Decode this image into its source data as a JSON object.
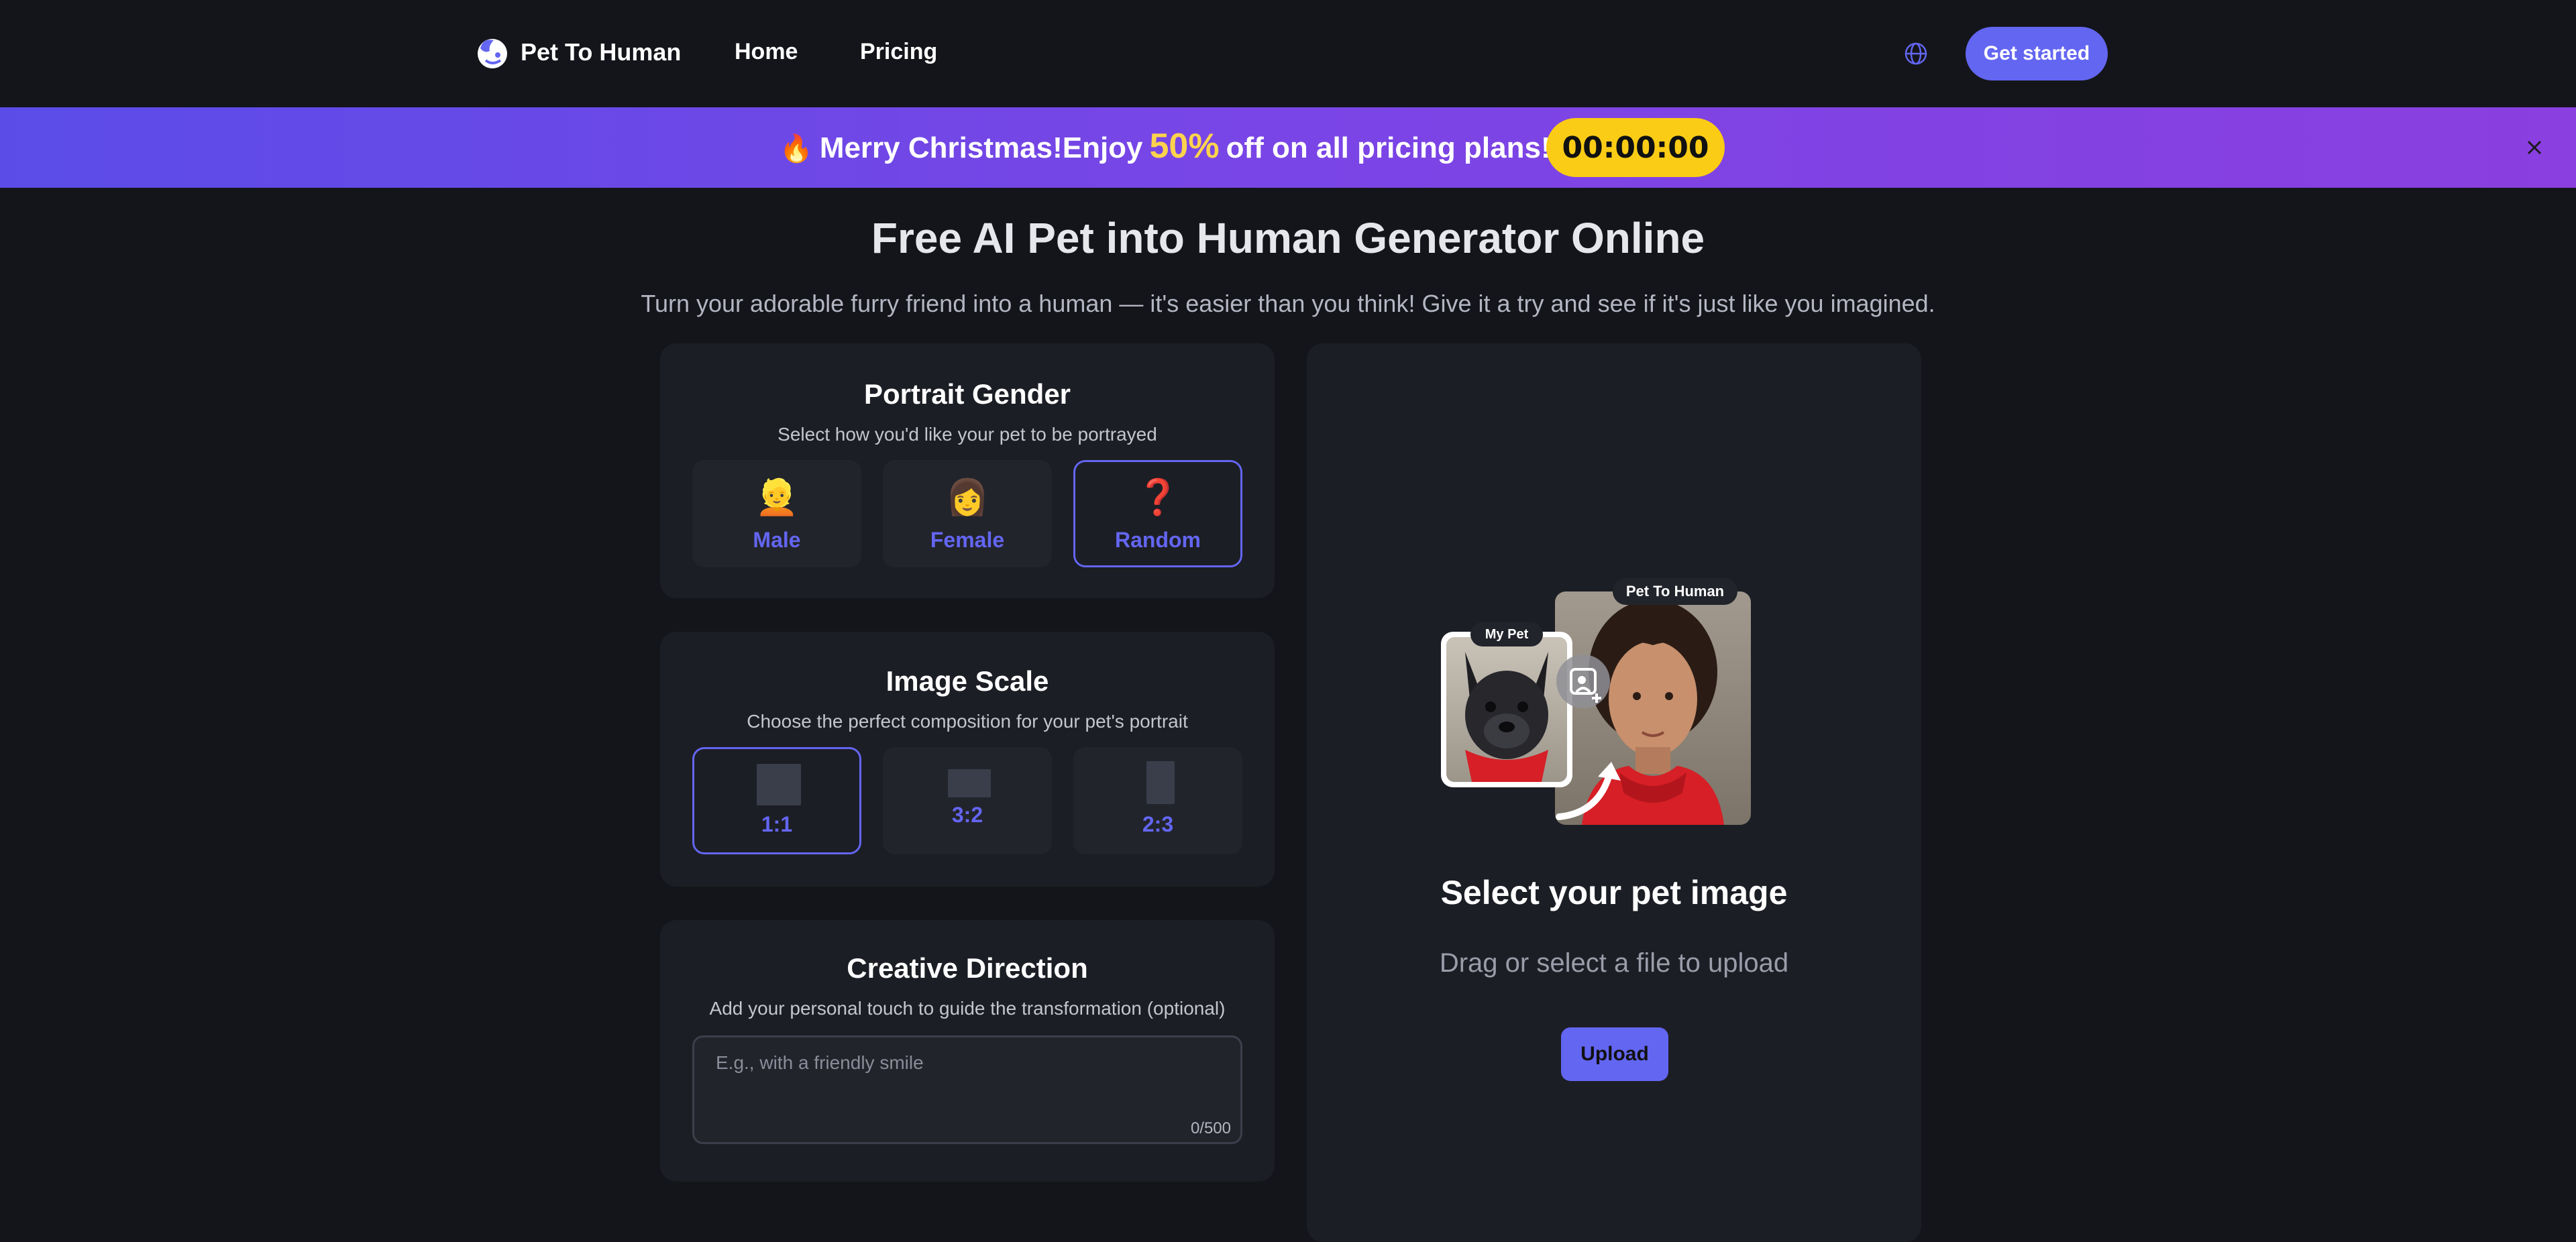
{
  "nav": {
    "brand": "Pet To Human",
    "links": [
      "Home",
      "Pricing"
    ],
    "cta": "Get started",
    "icons": {
      "logo": "pet-logo-icon",
      "language": "globe-icon"
    }
  },
  "promo": {
    "fire_icon": "🔥",
    "text_before": "Merry Christmas!Enjoy",
    "discount": "50%",
    "text_after": "off on all pricing plans!",
    "countdown": "00:00:00",
    "close_icon": "close-icon"
  },
  "hero": {
    "title": "Free AI Pet into Human Generator Online",
    "subtitle": "Turn your adorable furry friend into a human — it's easier than you think! Give it a try and see if it's just like you imagined."
  },
  "gender": {
    "title": "Portrait Gender",
    "subtitle": "Select how you'd like your pet to be portrayed",
    "options": [
      {
        "emoji": "👱",
        "label": "Male",
        "selected": false
      },
      {
        "emoji": "👩",
        "label": "Female",
        "selected": false
      },
      {
        "emoji": "❓",
        "label": "Random",
        "selected": true
      }
    ]
  },
  "scale": {
    "title": "Image Scale",
    "subtitle": "Choose the perfect composition for your pet's portrait",
    "options": [
      {
        "label": "1:1",
        "selected": true
      },
      {
        "label": "3:2",
        "selected": false
      },
      {
        "label": "2:3",
        "selected": false
      }
    ]
  },
  "creative": {
    "title": "Creative Direction",
    "subtitle": "Add your personal touch to guide the transformation (optional)",
    "placeholder": "E.g., with a friendly smile",
    "char_count": "0/500"
  },
  "upload": {
    "preview_labels": {
      "pet": "My Pet",
      "human": "Pet To Human"
    },
    "title": "Select your pet image",
    "subtitle": "Drag or select a file to upload",
    "button": "Upload"
  },
  "colors": {
    "background": "#14151a",
    "panel": "#1c1e25",
    "accent": "#6366f1",
    "countdown": "#facc15",
    "discount": "#fcd34d"
  }
}
